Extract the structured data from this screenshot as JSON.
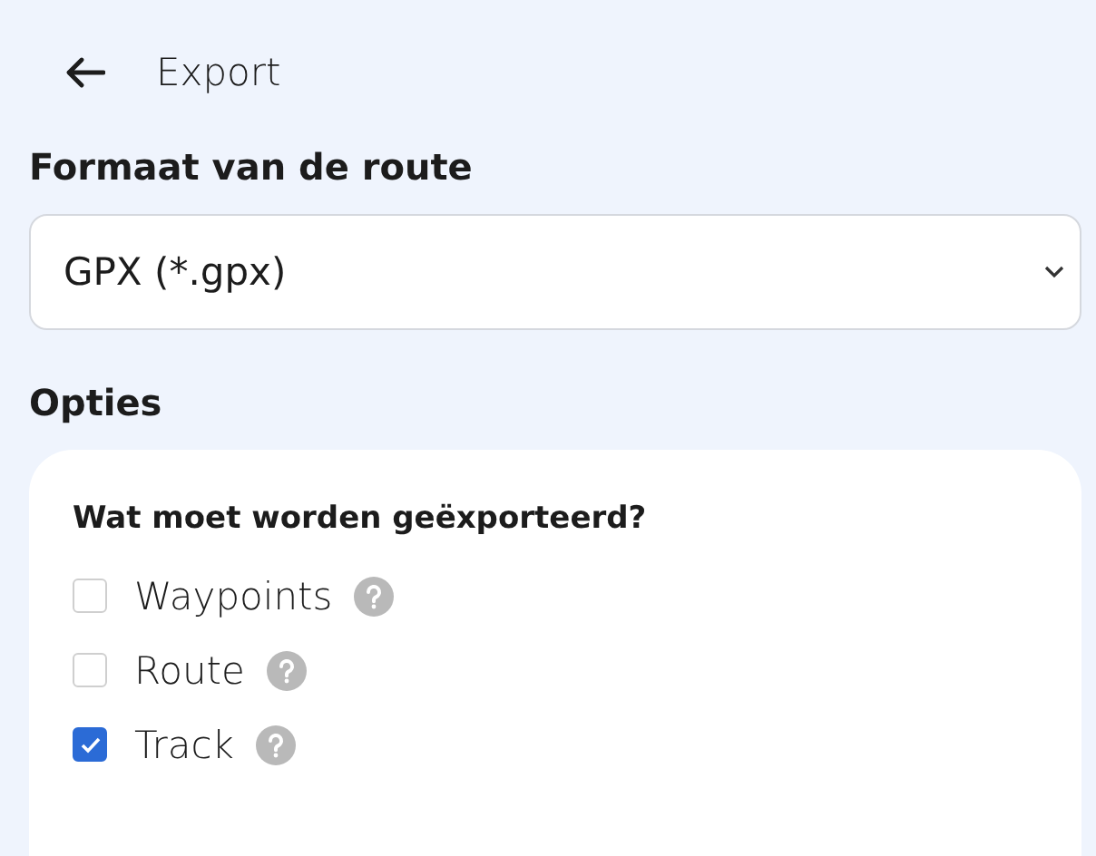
{
  "header": {
    "title": "Export"
  },
  "format": {
    "label": "Formaat van de route",
    "value": "GPX (*.gpx)"
  },
  "options": {
    "heading": "Opties",
    "question": "Wat moet worden geëxporteerd?",
    "items": [
      {
        "label": "Waypoints",
        "checked": false
      },
      {
        "label": "Route",
        "checked": false
      },
      {
        "label": "Track",
        "checked": true
      }
    ]
  }
}
